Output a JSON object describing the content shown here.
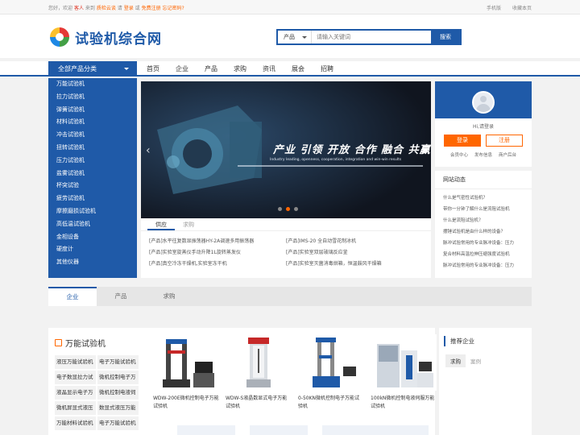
{
  "topbar": {
    "greeting": "您好，欢迎",
    "guest": "客人",
    "to": "来到",
    "site_link": "质检云谈",
    "please": "请",
    "login": "登录",
    "or": "或",
    "register": "免费注册",
    "forgot": "忘记密码?",
    "mobile": "手机版",
    "bookmark": "收藏本页"
  },
  "logo": {
    "text": "试验机综合网"
  },
  "search": {
    "category": "产品",
    "placeholder": "请输入关键词",
    "button": "搜索"
  },
  "nav": {
    "all_categories": "全部产品分类",
    "items": [
      "首页",
      "企业",
      "产品",
      "求购",
      "资讯",
      "展会",
      "招聘"
    ]
  },
  "sidebar": {
    "items": [
      "万能试验机",
      "拉力试验机",
      "弹簧试验机",
      "材料试验机",
      "冲击试验机",
      "扭转试验机",
      "压力试验机",
      "盐雾试验机",
      "杯突试验",
      "疲劳试验机",
      "摩擦磨损试验机",
      "高低温试验机",
      "金相设备",
      "硬度计",
      "其他仪器"
    ]
  },
  "banner": {
    "slogan": "产业 引领  开放 合作  融合 共赢",
    "subtitle": "Industry leading, openness, cooperation, integration and win-win results"
  },
  "info": {
    "tabs": [
      "供应",
      "求购"
    ],
    "items": [
      "[产品]水平往复数显振荡器HY-2A调速多用振荡器",
      "[产品]IMS-20 全自动雪花制冰机",
      "[产品]实验室旋蒸仪手动升降1L旋转蒸发仪",
      "[产品]实验室双层玻璃反应釜",
      "[产品]真空冷冻干燥机,实验室冻干机",
      "[产品]实验室灭菌消毒烘箱，恒温鼓风干燥箱"
    ]
  },
  "user": {
    "greeting": "Hi,请登录",
    "login": "登录",
    "register": "注册",
    "links": [
      "会员中心",
      "发布信息",
      "商户后台"
    ]
  },
  "news": {
    "title": "网站动态",
    "items": [
      "什么是气密性试验机？",
      "带你一分钟了解什么是流阻试验机",
      "什么是流阻试验机？",
      "摆锤试验机是由什么样的设备？",
      "脉冲试验常用的专业脉冲设备：压力",
      "复合材料高温拉伸压缩强度试验机",
      "脉冲试验常用的专业脉冲设备：压力"
    ]
  },
  "content_tabs": [
    "企业",
    "产品",
    "求购"
  ],
  "products": {
    "heading": "万能试验机",
    "subcats": [
      "液压万能试验机",
      "电子万能试验机",
      "电子数显拉力试",
      "微机控制电子万",
      "液晶显示电子万",
      "微机控制电液伺",
      "微机屏显式液压",
      "数显式液压万能",
      "万能材料试验机",
      "电子万能试验机"
    ],
    "cards": [
      {
        "name": "WDW-200E微机控制电子万能试验机"
      },
      {
        "name": "WDW-S液晶数显式电子万能试验机"
      },
      {
        "name": "0-50KN微机控制电子万能试验机"
      },
      {
        "name": "100kN微机控制电液伺服万能试验机"
      }
    ]
  },
  "recommend": {
    "title": "推荐企业",
    "tabs": [
      "求购",
      "案例"
    ]
  },
  "colors": {
    "primary": "#1f5aa8",
    "accent": "#ff6600",
    "sidebar_bg": "#1f5aa8"
  }
}
